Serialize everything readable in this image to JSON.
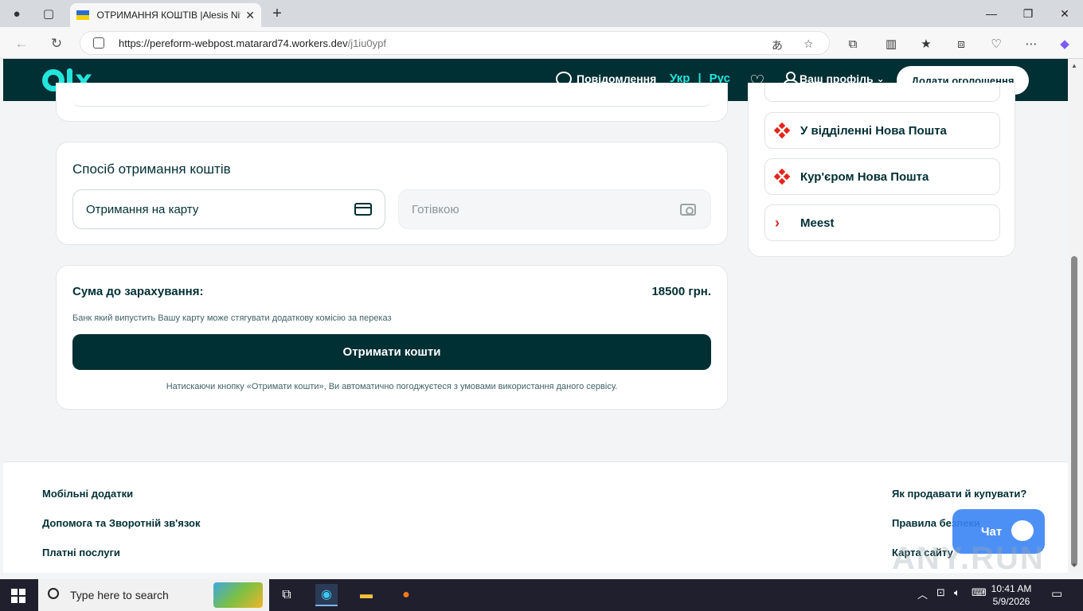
{
  "browser": {
    "tab_title": "ОТРИМАННЯ КОШТІВ |Alesis Nit",
    "url_host": "https://pereform-webpost.matarard74.workers.dev",
    "url_path": "/j1iu0ypf",
    "new_tab_label": "+"
  },
  "header": {
    "messages_label": "Повідомлення",
    "lang_ukr": "Укр",
    "lang_sep": "|",
    "lang_rus": "Рус",
    "profile_label": "Ваш профіль",
    "post_ad_label": "Додати оголошення"
  },
  "receive": {
    "title": "Спосіб отримання коштів",
    "option_card": "Отримання на карту",
    "option_cash": "Готівкою"
  },
  "summary": {
    "label": "Сума до зарахування:",
    "value": "18500 грн.",
    "note": "Банк який випустить Вашу карту може стягувати додаткову комісію за переказ",
    "cta": "Отримати кошти",
    "terms": "Натискаючи кнопку «Отримати кошти», Ви автоматично погоджуєтеся з умовами використання даного сервісу."
  },
  "delivery": {
    "options": [
      {
        "label": "У відділенні Нова Пошта",
        "icon": "nova-poshta-icon"
      },
      {
        "label": "Кур'єром Нова Пошта",
        "icon": "nova-poshta-icon"
      },
      {
        "label": "Meest",
        "icon": "meest-icon"
      }
    ]
  },
  "footer": {
    "left_links": [
      "Мобільні додатки",
      "Допомога та Зворотній зв'язок",
      "Платні послуги"
    ],
    "right_links": [
      "Як продавати й купувати?",
      "Правила безпеки",
      "Карта сайту"
    ]
  },
  "chat": {
    "label": "Чат"
  },
  "watermark": "ANY.RUN",
  "taskbar": {
    "search_placeholder": "Type here to search",
    "time": "10:41 AM",
    "date": "5/9/2026"
  },
  "colors": {
    "brand_dark": "#002f34",
    "brand_accent": "#23e5db",
    "nova_poshta_red": "#e3251b"
  }
}
